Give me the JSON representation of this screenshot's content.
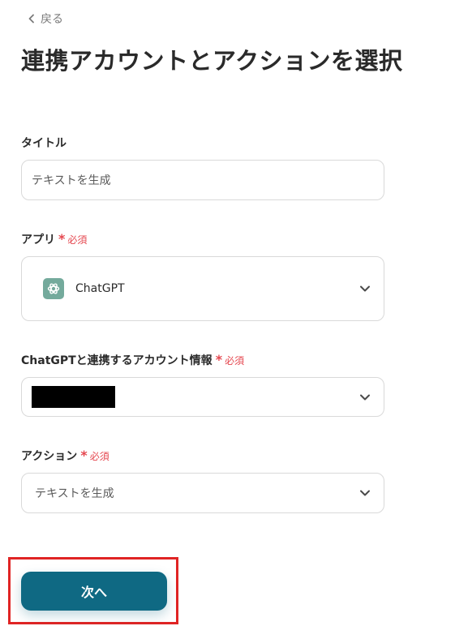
{
  "header": {
    "back_label": "戻る",
    "title": "連携アカウントとアクションを選択"
  },
  "required_label": "必須",
  "fields": {
    "title": {
      "label": "タイトル",
      "value": "テキストを生成"
    },
    "app": {
      "label": "アプリ",
      "required": true,
      "value": "ChatGPT",
      "icon": "chatgpt-logo-icon"
    },
    "account": {
      "label": "ChatGPTと連携するアカウント情報",
      "required": true,
      "value_redacted": true
    },
    "action": {
      "label": "アクション",
      "required": true,
      "value": "テキストを生成"
    }
  },
  "footer": {
    "next_label": "次へ"
  },
  "colors": {
    "primary_button": "#0f6983",
    "required": "#e5474f",
    "highlight_frame": "#e02424",
    "chatgpt_logo_bg": "#74aa9c"
  }
}
